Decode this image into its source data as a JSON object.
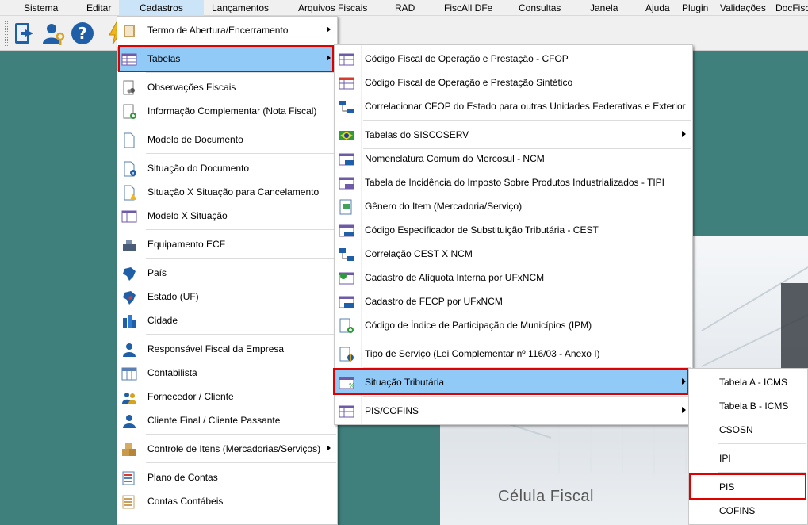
{
  "menubar": {
    "items": [
      "Sistema",
      "Editar",
      "Cadastros",
      "Lançamentos",
      "Arquivos Fiscais",
      "RAD",
      "FiscAll DFe",
      "Consultas",
      "Janela",
      "Ajuda",
      "Plugin",
      "Validações",
      "DocFisc"
    ]
  },
  "toolbar": {
    "buttons": [
      "exit-icon",
      "user-key-icon",
      "help-icon",
      "lightning-icon"
    ]
  },
  "splash": {
    "text": "Célula Fiscal"
  },
  "cadastros_menu": {
    "items": [
      {
        "label": "Termo de Abertura/Encerramento",
        "icon": "book-icon",
        "submenu": true
      },
      {
        "label": "Tabelas",
        "icon": "table-icon",
        "submenu": true
      },
      {
        "label": "Observações Fiscais",
        "icon": "document-people-icon"
      },
      {
        "label": "Informação Complementar (Nota Fiscal)",
        "icon": "document-plus-icon"
      },
      {
        "label": "Modelo de Documento",
        "icon": "blank-document-icon"
      },
      {
        "label": "Situação do Documento",
        "icon": "document-info-icon"
      },
      {
        "label": "Situação X Situação para Cancelamento",
        "icon": "document-warning-icon"
      },
      {
        "label": "Modelo X Situação",
        "icon": "document-grid-icon"
      },
      {
        "label": "Equipamento ECF",
        "icon": "cash-register-icon"
      },
      {
        "label": "País",
        "icon": "brazil-map-icon"
      },
      {
        "label": "Estado (UF)",
        "icon": "state-map-icon"
      },
      {
        "label": "Cidade",
        "icon": "buildings-icon"
      },
      {
        "label": "Responsável Fiscal da Empresa",
        "icon": "person-icon"
      },
      {
        "label": "Contabilista",
        "icon": "calendar-grid-icon"
      },
      {
        "label": "Fornecedor / Cliente",
        "icon": "people-icon"
      },
      {
        "label": "Cliente Final / Cliente Passante",
        "icon": "person-icon"
      },
      {
        "label": "Controle de Itens (Mercadorias/Serviços)",
        "icon": "boxes-icon",
        "submenu": true
      },
      {
        "label": "Plano de Contas",
        "icon": "chart-of-accounts-icon"
      },
      {
        "label": "Contas Contábeis",
        "icon": "ledger-icon"
      }
    ]
  },
  "tabelas_menu": {
    "items": [
      {
        "label": "Código Fiscal de Operação e Prestação - CFOP",
        "icon": "cfop-table-icon"
      },
      {
        "label": "Código Fiscal de Operação e Prestação Sintético",
        "icon": "cfop-synthetic-icon"
      },
      {
        "label": "Correlacionar CFOP do Estado para outras Unidades Federativas e Exterior",
        "icon": "correlation-icon"
      },
      {
        "label": "Tabelas do SISCOSERV",
        "icon": "brazil-flag-icon",
        "submenu": true
      },
      {
        "label": "Nomenclatura Comum do Mercosul - NCM",
        "icon": "ncm-table-icon"
      },
      {
        "label": "Tabela de Incidência do Imposto Sobre Produtos Industrializados - TIPI",
        "icon": "tipi-table-icon"
      },
      {
        "label": "Gênero do Item (Mercadoria/Serviço)",
        "icon": "money-document-icon"
      },
      {
        "label": "Código Especificador de Substituição Tributária - CEST",
        "icon": "cest-table-icon"
      },
      {
        "label": "Correlação CEST X NCM",
        "icon": "correlation-icon"
      },
      {
        "label": "Cadastro de Alíquota Interna por UFxNCM",
        "icon": "rate-table-icon"
      },
      {
        "label": "Cadastro de FECP por UFxNCM",
        "icon": "fecp-table-icon"
      },
      {
        "label": "Código de Índice de Participação de Municípios (IPM)",
        "icon": "ipm-document-icon"
      },
      {
        "label": "Tipo de Serviço (Lei Complementar nº 116/03 - Anexo I)",
        "icon": "service-type-icon"
      },
      {
        "label": "Situação Tributária",
        "icon": "tax-status-icon",
        "submenu": true
      },
      {
        "label": "PIS/COFINS",
        "icon": "pis-cofins-table-icon",
        "submenu": true
      }
    ]
  },
  "situacao_menu": {
    "items": [
      {
        "label": "Tabela A - ICMS"
      },
      {
        "label": "Tabela B - ICMS"
      },
      {
        "label": "CSOSN"
      },
      {
        "label": "IPI"
      },
      {
        "label": "PIS"
      },
      {
        "label": "COFINS"
      }
    ]
  },
  "colors": {
    "highlight": "#91c9f7",
    "annotation": "#e00000",
    "desktop": "#3f7f7c"
  }
}
